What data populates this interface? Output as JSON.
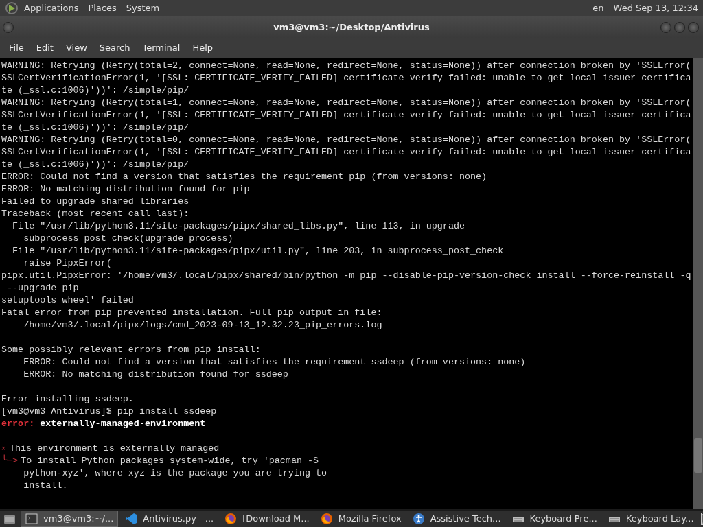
{
  "top_panel": {
    "menus": [
      "Applications",
      "Places",
      "System"
    ],
    "keyboard_layout": "en",
    "clock": "Wed Sep 13, 12:34"
  },
  "window": {
    "title": "vm3@vm3:~/Desktop/Antivirus"
  },
  "menu_bar": [
    "File",
    "Edit",
    "View",
    "Search",
    "Terminal",
    "Help"
  ],
  "terminal_lines": [
    {
      "kind": "plain",
      "text": "WARNING: Retrying (Retry(total=2, connect=None, read=None, redirect=None, status=None)) after connection broken by 'SSLError("
    },
    {
      "kind": "plain",
      "text": "SSLCertVerificationError(1, '[SSL: CERTIFICATE_VERIFY_FAILED] certificate verify failed: unable to get local issuer certifica"
    },
    {
      "kind": "plain",
      "text": "te (_ssl.c:1006)'))': /simple/pip/"
    },
    {
      "kind": "plain",
      "text": "WARNING: Retrying (Retry(total=1, connect=None, read=None, redirect=None, status=None)) after connection broken by 'SSLError("
    },
    {
      "kind": "plain",
      "text": "SSLCertVerificationError(1, '[SSL: CERTIFICATE_VERIFY_FAILED] certificate verify failed: unable to get local issuer certifica"
    },
    {
      "kind": "plain",
      "text": "te (_ssl.c:1006)'))': /simple/pip/"
    },
    {
      "kind": "plain",
      "text": "WARNING: Retrying (Retry(total=0, connect=None, read=None, redirect=None, status=None)) after connection broken by 'SSLError("
    },
    {
      "kind": "plain",
      "text": "SSLCertVerificationError(1, '[SSL: CERTIFICATE_VERIFY_FAILED] certificate verify failed: unable to get local issuer certifica"
    },
    {
      "kind": "plain",
      "text": "te (_ssl.c:1006)'))': /simple/pip/"
    },
    {
      "kind": "plain",
      "text": "ERROR: Could not find a version that satisfies the requirement pip (from versions: none)"
    },
    {
      "kind": "plain",
      "text": "ERROR: No matching distribution found for pip"
    },
    {
      "kind": "plain",
      "text": "Failed to upgrade shared libraries"
    },
    {
      "kind": "plain",
      "text": "Traceback (most recent call last):"
    },
    {
      "kind": "plain",
      "text": "  File \"/usr/lib/python3.11/site-packages/pipx/shared_libs.py\", line 113, in upgrade"
    },
    {
      "kind": "plain",
      "text": "    subprocess_post_check(upgrade_process)"
    },
    {
      "kind": "plain",
      "text": "  File \"/usr/lib/python3.11/site-packages/pipx/util.py\", line 203, in subprocess_post_check"
    },
    {
      "kind": "plain",
      "text": "    raise PipxError("
    },
    {
      "kind": "plain",
      "text": "pipx.util.PipxError: '/home/vm3/.local/pipx/shared/bin/python -m pip --disable-pip-version-check install --force-reinstall -q"
    },
    {
      "kind": "plain",
      "text": " --upgrade pip"
    },
    {
      "kind": "plain",
      "text": "setuptools wheel' failed"
    },
    {
      "kind": "plain",
      "text": "Fatal error from pip prevented installation. Full pip output in file:"
    },
    {
      "kind": "plain",
      "text": "    /home/vm3/.local/pipx/logs/cmd_2023-09-13_12.32.23_pip_errors.log"
    },
    {
      "kind": "blank"
    },
    {
      "kind": "plain",
      "text": "Some possibly relevant errors from pip install:"
    },
    {
      "kind": "plain",
      "text": "    ERROR: Could not find a version that satisfies the requirement ssdeep (from versions: none)"
    },
    {
      "kind": "plain",
      "text": "    ERROR: No matching distribution found for ssdeep"
    },
    {
      "kind": "blank"
    },
    {
      "kind": "plain",
      "text": "Error installing ssdeep."
    },
    {
      "kind": "prompt",
      "text": "[vm3@vm3 Antivirus]$ pip install ssdeep"
    },
    {
      "kind": "error",
      "label": "error:",
      "text": "externally-managed-environment"
    },
    {
      "kind": "blank"
    },
    {
      "kind": "mark",
      "marker": "×",
      "text": "This environment is externally managed"
    },
    {
      "kind": "arrow",
      "marker": "╰─>",
      "text": "To install Python packages system-wide, try 'pacman -S"
    },
    {
      "kind": "plain",
      "text": "    python-xyz', where xyz is the package you are trying to"
    },
    {
      "kind": "plain",
      "text": "    install."
    }
  ],
  "taskbar": [
    {
      "kind": "desktop"
    },
    {
      "kind": "terminal",
      "label": "vm3@vm3:~/...",
      "selected": true
    },
    {
      "kind": "editor",
      "label": "Antivirus.py - ...",
      "selected": false
    },
    {
      "kind": "firefox",
      "label": "[Download M...",
      "selected": false
    },
    {
      "kind": "firefox",
      "label": "Mozilla Firefox",
      "selected": false
    },
    {
      "kind": "accessibility",
      "label": "Assistive Tech...",
      "selected": false
    },
    {
      "kind": "keyboard",
      "label": "Keyboard Pre...",
      "selected": false
    },
    {
      "kind": "keyboard",
      "label": "Keyboard Lay...",
      "selected": false
    },
    {
      "kind": "terminal-small"
    }
  ]
}
